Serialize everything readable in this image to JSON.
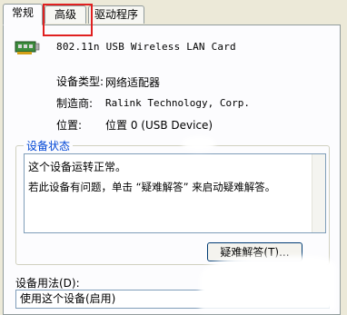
{
  "tabs": [
    {
      "label": "常规",
      "active": true
    },
    {
      "label": "高级",
      "active": false
    },
    {
      "label": "驱动程序",
      "active": false
    }
  ],
  "device": {
    "icon": "network-card-icon",
    "name": "802.11n USB Wireless LAN Card"
  },
  "properties": {
    "type_label": "设备类型:",
    "type_value": "网络适配器",
    "manufacturer_label": "制造商:",
    "manufacturer_value": "Ralink Technology, Corp.",
    "location_label": "位置:",
    "location_value": "位置 0 (USB Device)"
  },
  "status": {
    "group_title": "设备状态",
    "line1": "这个设备运转正常。",
    "line2": "若此设备有问题，单击 “疑难解答” 来启动疑难解答。",
    "troubleshoot_button": "疑难解答(T)..."
  },
  "usage": {
    "label": "设备用法(D):",
    "selected": "使用这个设备(启用)"
  },
  "colors": {
    "highlight": "#e02020",
    "group_title": "#0046d5"
  }
}
